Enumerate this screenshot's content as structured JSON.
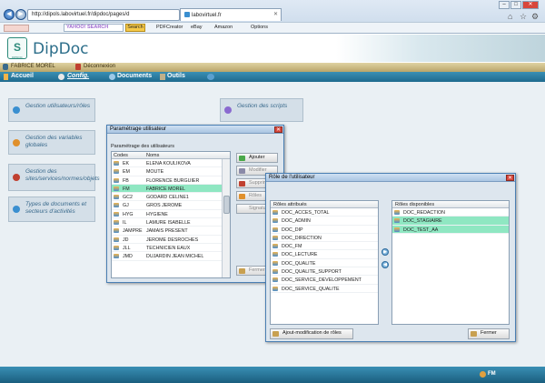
{
  "browser": {
    "url": "http://dipols.labovirtuel.fr/dipdoc/pages/d",
    "tab_title": "labovirtuel.fr",
    "toolbar": {
      "search_placeholder": "YAHOO! SEARCH",
      "search_button": "Search",
      "items": [
        "PDFCreator",
        "eBay",
        "Amazon",
        "Options"
      ]
    }
  },
  "app": {
    "brand": "DipDoc",
    "logo_label": "DIPDOC",
    "user": "FABRICE MOREL",
    "logout": "Déconnexion",
    "menu": [
      "Accueil",
      "Config.",
      "Documents",
      "Outils"
    ],
    "footer_label": "FM"
  },
  "tiles": [
    {
      "label": "Gestion utilisateurs/rôles",
      "color": "#3a8fd0"
    },
    {
      "label": "Gestion des variables globales",
      "color": "#e0902c"
    },
    {
      "label": "Gestion des sites/services/normes/objets",
      "color": "#c04030"
    },
    {
      "label": "Types de documents et secteurs d'activités",
      "color": "#3a8fd0"
    },
    {
      "label": "Gestion des scripts",
      "color": "#8a6ad0"
    }
  ],
  "dialog_user": {
    "title": "Paramétrage utilisateur",
    "section": "Paramétrage des utilisateurs",
    "columns": [
      "Codes",
      "Noms"
    ],
    "rows": [
      {
        "code": "EK",
        "name": "ELENA KOULIKOVA"
      },
      {
        "code": "EM",
        "name": "MOUTE"
      },
      {
        "code": "FB",
        "name": "FLORENCE BURGUIER"
      },
      {
        "code": "FM",
        "name": "FABRICE MOREL",
        "selected": true
      },
      {
        "code": "GC2",
        "name": "GODARD CELINE1"
      },
      {
        "code": "GJ",
        "name": "GROS JEROME"
      },
      {
        "code": "HYG",
        "name": "HYGIENE"
      },
      {
        "code": "IL",
        "name": "LAMURE ISABELLE"
      },
      {
        "code": "JAMPRE",
        "name": "JAMAIS PRESENT"
      },
      {
        "code": "JD",
        "name": "JEROME DESROCHES"
      },
      {
        "code": "JLL",
        "name": "TECHNICIEN EAUX"
      },
      {
        "code": "JMD",
        "name": "DUJARDIN JEAN MICHEL"
      }
    ],
    "buttons": [
      "Ajouter",
      "Modifier",
      "Supprimer",
      "Rôles",
      "Signature"
    ],
    "close_button": "Fermer"
  },
  "dialog_roles": {
    "title": "Rôle de l'utilisateur",
    "assigned_header": "Rôles attribués",
    "available_header": "Rôles disponibles",
    "assigned": [
      "DOC_ACCES_TOTAL",
      "DOC_ADMIN",
      "DOC_DIP",
      "DOC_DIRECTION",
      "DOC_FM",
      "DOC_LECTURE",
      "DOC_QUALITE",
      "DOC_QUALITE_SUPPORT",
      "DOC_SERVICE_DEVELOPPEMENT",
      "DOC_SERVICE_QUALITE"
    ],
    "available": [
      {
        "label": "DOC_REDACTION",
        "selected": false
      },
      {
        "label": "DOC_STAGIAIRE",
        "selected": true
      },
      {
        "label": "DOC_TEST_AA",
        "selected": true
      }
    ],
    "modify_button": "Ajout-modification de rôles",
    "close_button": "Fermer"
  }
}
